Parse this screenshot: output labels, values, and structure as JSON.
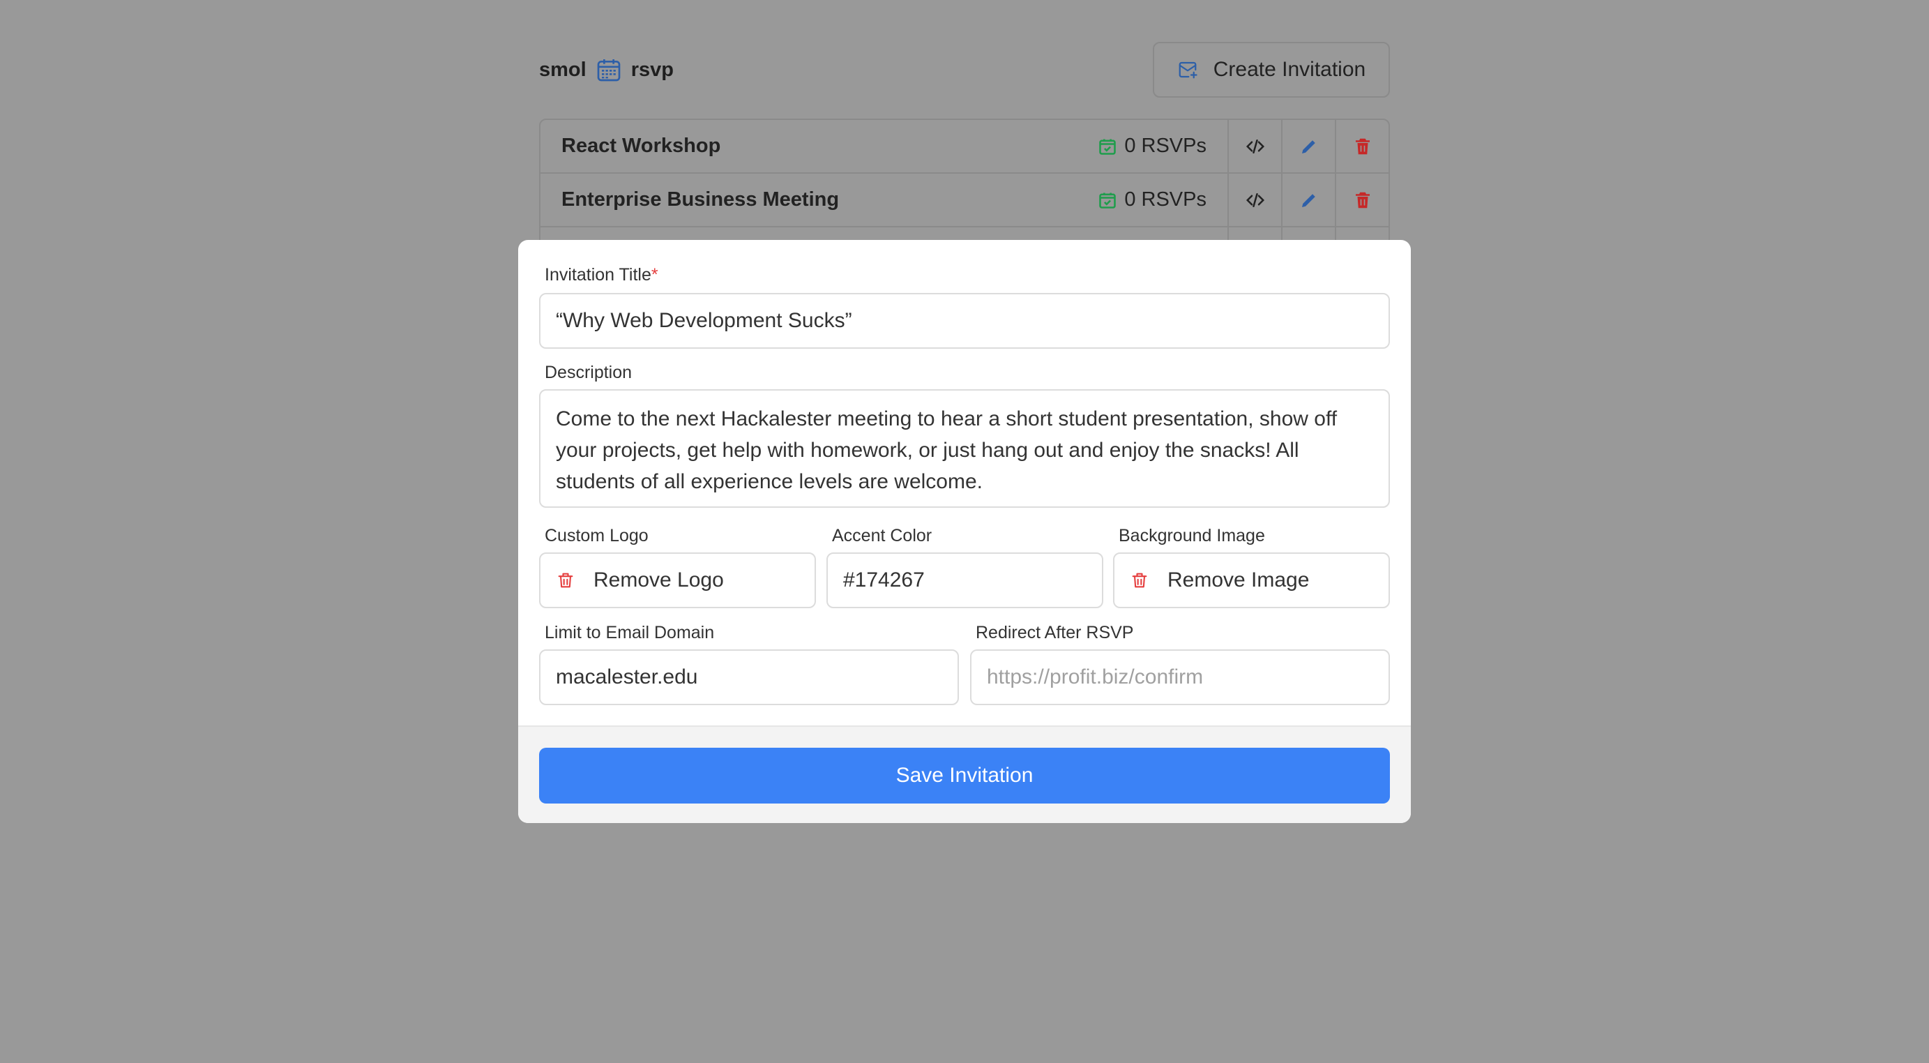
{
  "header": {
    "brand_left": "smol",
    "brand_right": "rsvp",
    "brand_icon": "calendar-icon",
    "create_label": "Create Invitation"
  },
  "invitations": [
    {
      "title": "React Workshop",
      "rsvps": "0 RSVPs"
    },
    {
      "title": "Enterprise Business Meeting",
      "rsvps": "0 RSVPs"
    }
  ],
  "modal": {
    "title_label": "Invitation Title",
    "required_mark": "*",
    "title_value": "“Why Web Development Sucks”",
    "description_label": "Description",
    "description_value": "Come to the next Hackalester meeting to hear a short student presentation, show off your projects, get help with homework, or just hang out and enjoy the snacks! All students of all experience levels are welcome.",
    "logo_label": "Custom Logo",
    "logo_button": "Remove Logo",
    "accent_label": "Accent Color",
    "accent_value": "#174267",
    "bg_label": "Background Image",
    "bg_button": "Remove Image",
    "domain_label": "Limit to Email Domain",
    "domain_value": "macalester.edu",
    "redirect_label": "Redirect After RSVP",
    "redirect_placeholder": "https://profit.biz/confirm",
    "save_label": "Save Invitation"
  },
  "colors": {
    "primary": "#3b82f6",
    "danger": "#e53e3e",
    "rsvp_green": "#16a34a",
    "brand_blue": "#2563eb",
    "overlay": "#999999"
  }
}
